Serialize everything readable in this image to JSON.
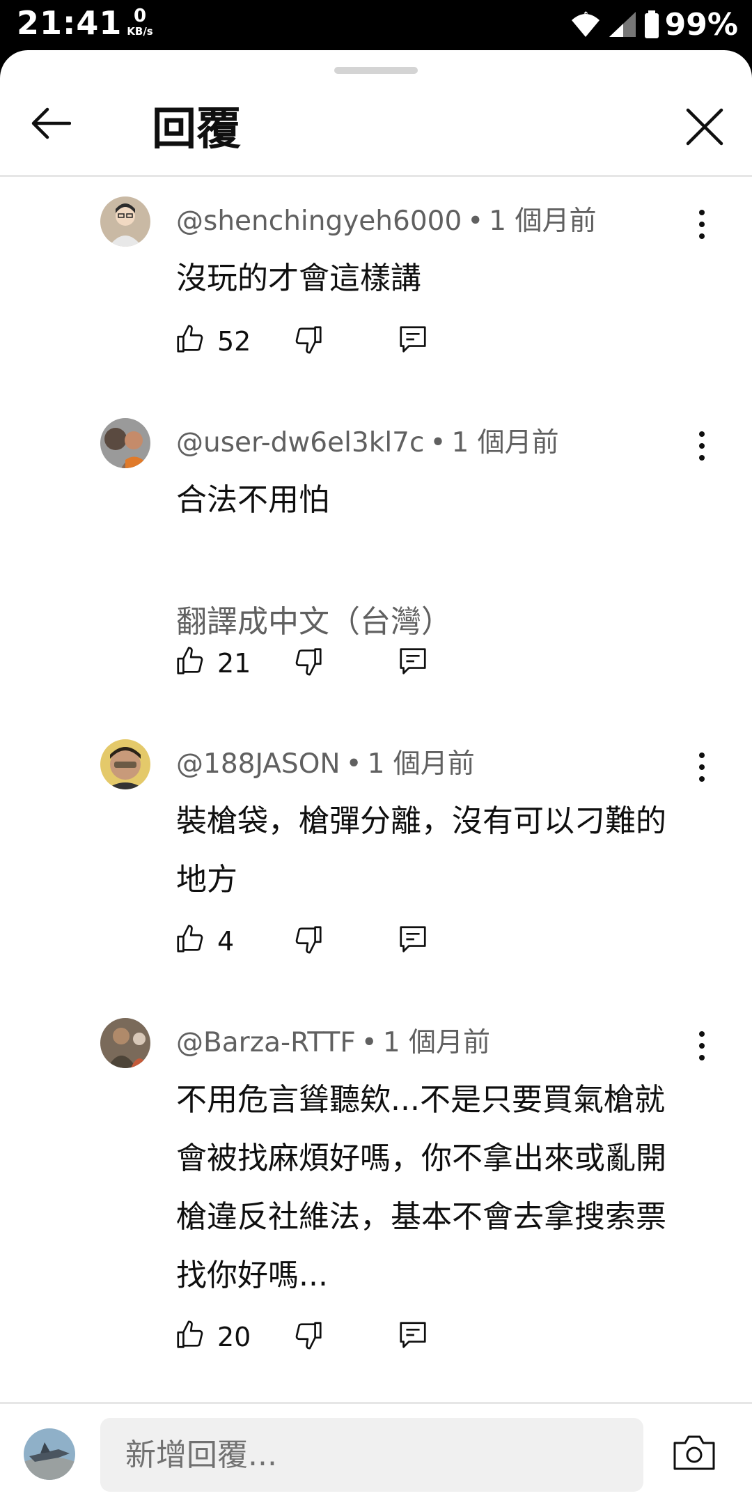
{
  "status_bar": {
    "time": "21:41",
    "speed_value": "0",
    "speed_unit": "KB/s",
    "battery": "99%"
  },
  "header": {
    "title": "回覆"
  },
  "comments": [
    {
      "handle": "@shenchingyeh6000",
      "time": "1 個月前",
      "text": "沒玩的才會這樣講",
      "likes": "52",
      "avatar_color": "#c9b9a4"
    },
    {
      "handle": "@user-dw6el3kl7c",
      "time": "1 個月前",
      "text": "合法不用怕",
      "translate": "翻譯成中文（台灣）",
      "likes": "21",
      "avatar_color": "#8a6a55"
    },
    {
      "handle": "@188JASON",
      "time": "1 個月前",
      "text": "裝槍袋，槍彈分離，沒有可以刁難的地方",
      "likes": "4",
      "avatar_color": "#6b5a45"
    },
    {
      "handle": "@Barza-RTTF",
      "time": "1 個月前",
      "text": "不用危言聳聽欸...不是只要買氣槍就會被找麻煩好嗎，你不拿出來或亂開槍違反社維法，基本不會去拿搜索票找你好嗎...",
      "likes": "20",
      "avatar_color": "#4d4438"
    }
  ],
  "composer": {
    "placeholder": "新增回覆..."
  },
  "colors": {
    "text_primary": "#0f0f0f",
    "text_secondary": "#606060",
    "divider": "#e6e6e6",
    "input_bg": "#f0f0f0"
  }
}
